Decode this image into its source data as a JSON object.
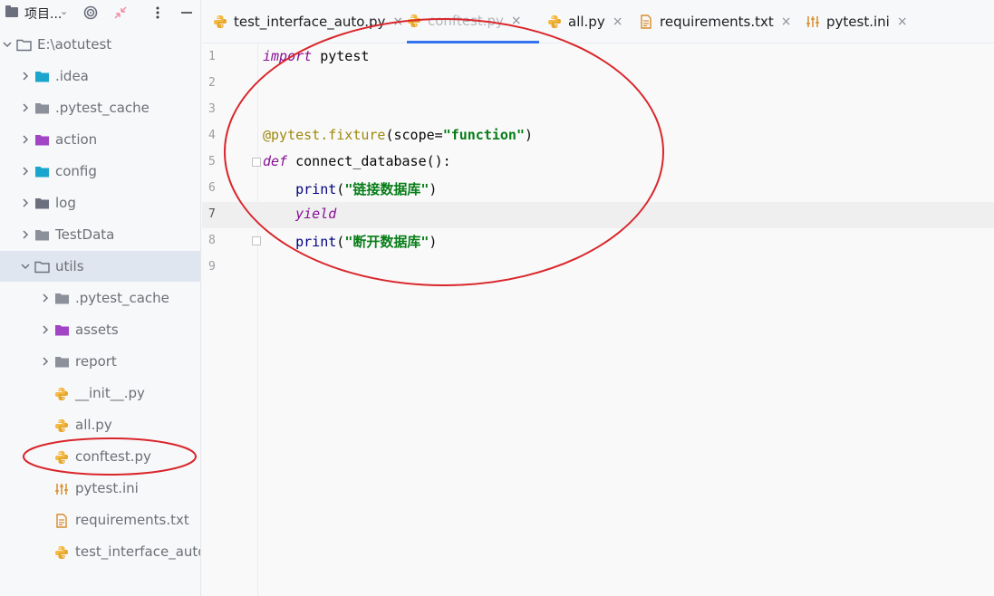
{
  "sidebar": {
    "title": "项目...",
    "toolbar_icons": [
      "target-icon",
      "collapse-icon",
      "more-icon",
      "minimize-icon"
    ],
    "tree": [
      {
        "label": "E:\\aotutest",
        "depth": 0,
        "type": "folder",
        "expanded": true,
        "color": "#6c707e"
      },
      {
        "label": ".idea",
        "depth": 1,
        "type": "folder",
        "expanded": false,
        "color": "#1aa6cc"
      },
      {
        "label": ".pytest_cache",
        "depth": 1,
        "type": "folder",
        "expanded": false,
        "color": "#8c909a"
      },
      {
        "label": "action",
        "depth": 1,
        "type": "folder",
        "expanded": false,
        "color": "#a145c6"
      },
      {
        "label": "config",
        "depth": 1,
        "type": "folder",
        "expanded": false,
        "color": "#1aa6cc"
      },
      {
        "label": "log",
        "depth": 1,
        "type": "folder",
        "expanded": false,
        "color": "#6c707e"
      },
      {
        "label": "TestData",
        "depth": 1,
        "type": "folder",
        "expanded": false,
        "color": "#8c909a"
      },
      {
        "label": "utils",
        "depth": 1,
        "type": "folder",
        "expanded": true,
        "color": "#6c707e",
        "selected": true
      },
      {
        "label": ".pytest_cache",
        "depth": 2,
        "type": "folder",
        "expanded": false,
        "color": "#8c909a"
      },
      {
        "label": "assets",
        "depth": 2,
        "type": "folder",
        "expanded": false,
        "color": "#a145c6"
      },
      {
        "label": "report",
        "depth": 2,
        "type": "folder",
        "expanded": false,
        "color": "#8c909a"
      },
      {
        "label": "__init__.py",
        "depth": 2,
        "type": "python"
      },
      {
        "label": "all.py",
        "depth": 2,
        "type": "python"
      },
      {
        "label": "conftest.py",
        "depth": 2,
        "type": "python"
      },
      {
        "label": "pytest.ini",
        "depth": 2,
        "type": "ini"
      },
      {
        "label": "requirements.txt",
        "depth": 2,
        "type": "txt"
      },
      {
        "label": "test_interface_auto.py",
        "depth": 2,
        "type": "python"
      }
    ]
  },
  "tabs": [
    {
      "label": "test_interface_auto.py",
      "type": "python",
      "active": false
    },
    {
      "label": "conftest.py",
      "type": "python",
      "active": true
    },
    {
      "label": "all.py",
      "type": "python",
      "active": false
    },
    {
      "label": "requirements.txt",
      "type": "txt",
      "active": false
    },
    {
      "label": "pytest.ini",
      "type": "ini",
      "active": false
    }
  ],
  "tab_close_glyph": "×",
  "editor": {
    "current_line": 7,
    "lines": [
      {
        "n": "1",
        "text": "import pytest"
      },
      {
        "n": "2",
        "text": ""
      },
      {
        "n": "3",
        "text": ""
      },
      {
        "n": "4",
        "text": "@pytest.fixture(scope=\"function\")"
      },
      {
        "n": "5",
        "text": "def connect_database():"
      },
      {
        "n": "6",
        "text": "    print(\"链接数据库\")"
      },
      {
        "n": "7",
        "text": "    yield"
      },
      {
        "n": "8",
        "text": "    print(\"断开数据库\")"
      },
      {
        "n": "9",
        "text": ""
      }
    ]
  },
  "annotation_color": "#d9262b"
}
